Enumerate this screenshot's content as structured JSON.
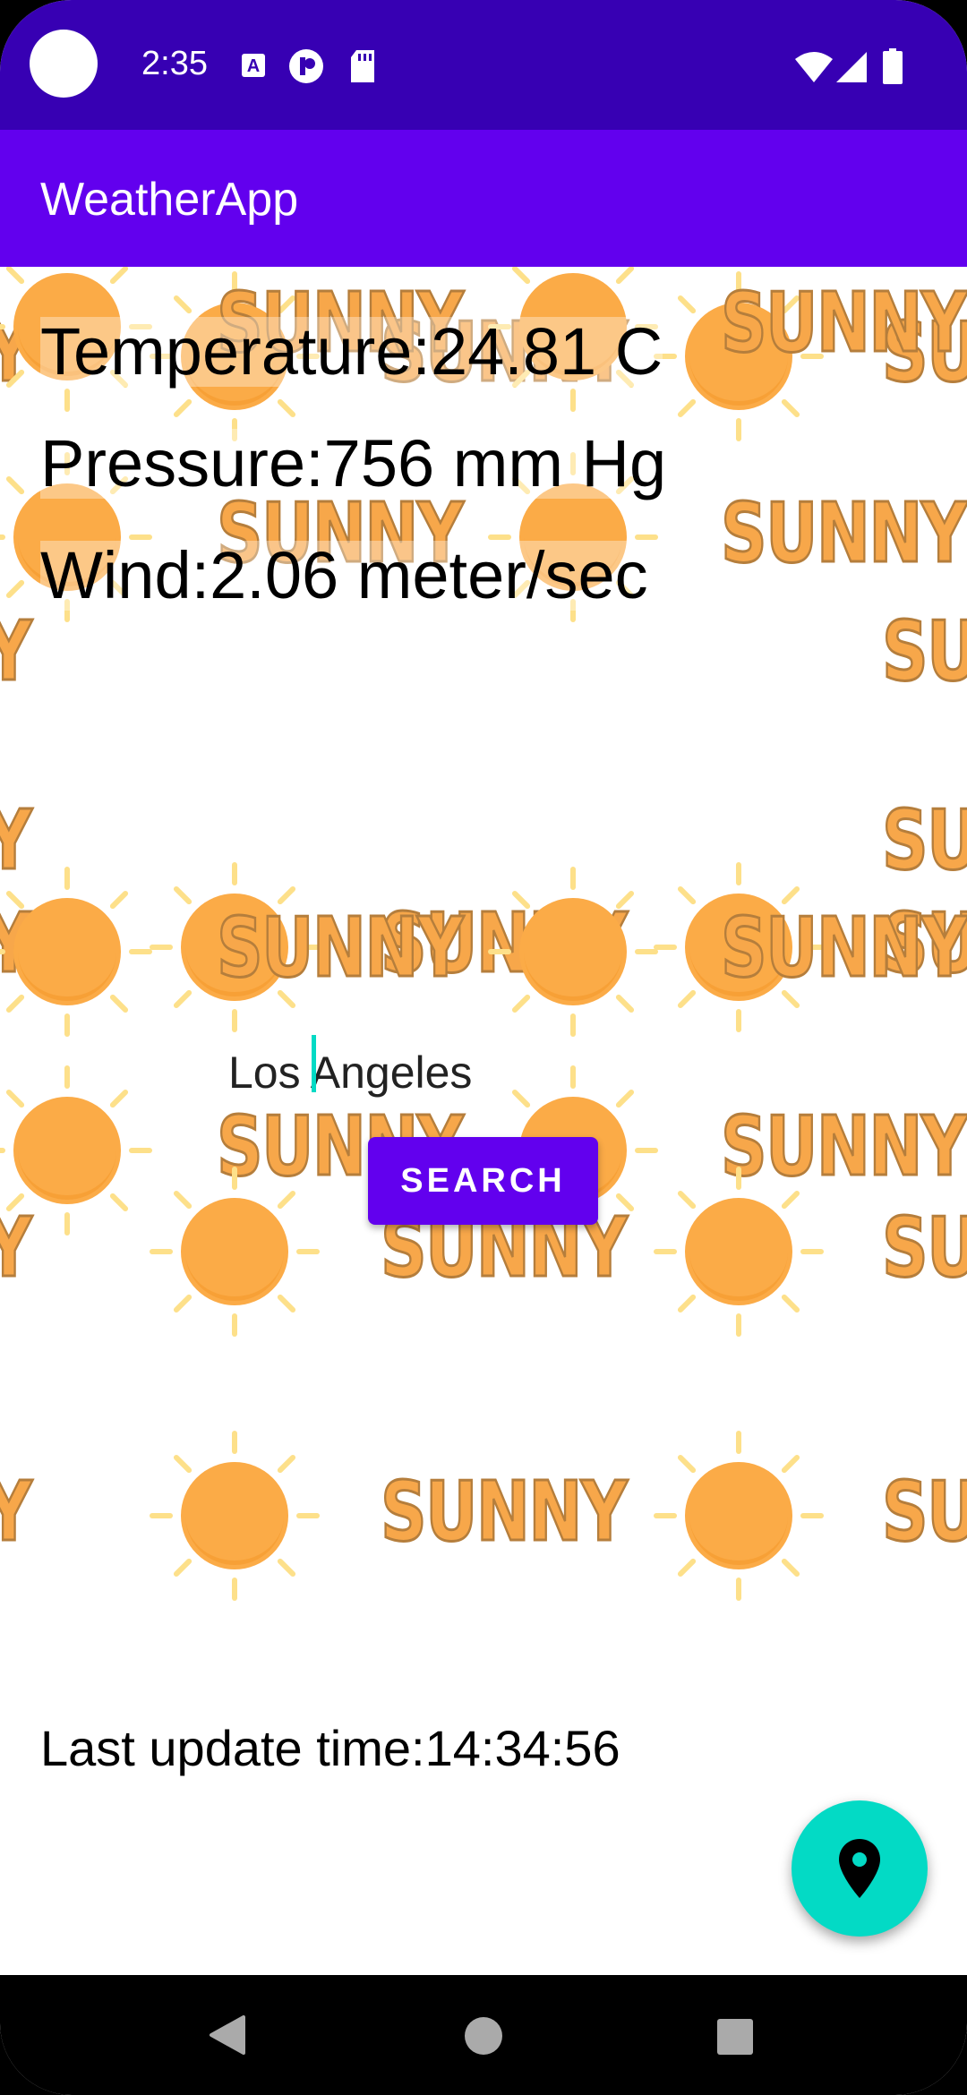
{
  "status_bar": {
    "time": "2:35",
    "left_icons": [
      "text-a-icon",
      "circle-p-icon",
      "sd-card-icon"
    ],
    "right_icons": [
      "wifi-icon",
      "signal-icon",
      "battery-icon"
    ]
  },
  "app_bar": {
    "title": "WeatherApp"
  },
  "weather": {
    "temperature_label": "Temperature:",
    "temperature_value": "24.81 C",
    "pressure_label": "Pressure:",
    "pressure_value": "756 mm Hg",
    "wind_label": "Wind:",
    "wind_value": "2.06 meter/sec"
  },
  "background": {
    "word": "SUNNY",
    "sun_color": "#fbab47"
  },
  "search": {
    "city_value": "Los Angeles",
    "button_label": "SEARCH"
  },
  "last_update": {
    "label": "Last update time:",
    "value": "14:34:56"
  },
  "fab": {
    "icon": "location-pin-icon"
  },
  "colors": {
    "status_bar": "#3700b3",
    "app_bar": "#6200ee",
    "button": "#6200ee",
    "fab": "#03dac5"
  }
}
